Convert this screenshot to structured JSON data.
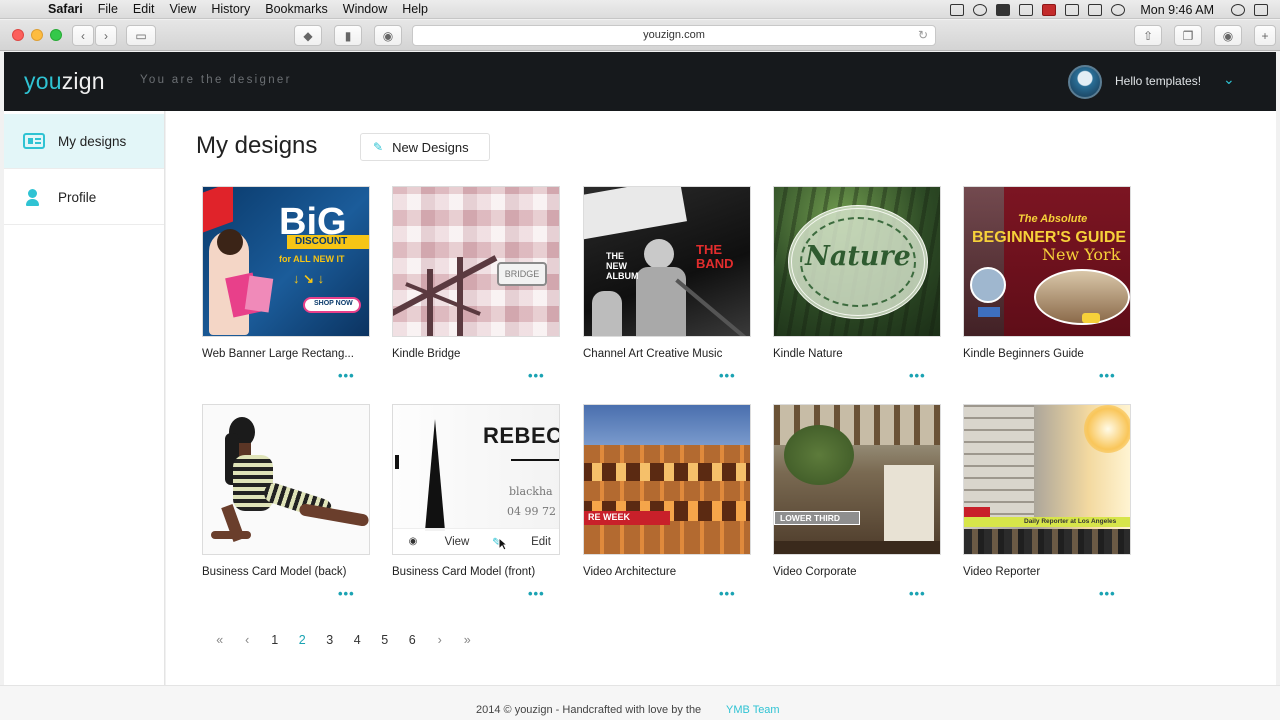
{
  "menubar": {
    "app": "Safari",
    "items": [
      "File",
      "Edit",
      "View",
      "History",
      "Bookmarks",
      "Window",
      "Help"
    ],
    "clock": "Mon 9:46 AM"
  },
  "browser": {
    "url": "youzign.com"
  },
  "header": {
    "logo_prefix": "you",
    "logo_suffix": "zign",
    "tagline": "You are the designer",
    "greeting": "Hello templates!",
    "chevron": "⌄"
  },
  "sidebar": {
    "items": [
      {
        "label": "My designs",
        "icon": "designs-icon",
        "active": true
      },
      {
        "label": "Profile",
        "icon": "profile-icon",
        "active": false
      }
    ]
  },
  "main": {
    "title": "My designs",
    "new_button": "New Designs"
  },
  "designs": [
    {
      "title": "Web Banner Large Rectang...",
      "thumb": "shopping-banner"
    },
    {
      "title": "Kindle Bridge",
      "thumb": "bridge",
      "label": "BRIDGE"
    },
    {
      "title": "Channel Art Creative Music",
      "thumb": "music",
      "label1": "THE NEW ALBUM",
      "label2": "THE BAND"
    },
    {
      "title": "Kindle Nature",
      "thumb": "nature",
      "label": "Nature"
    },
    {
      "title": "Kindle Beginners Guide",
      "thumb": "guide",
      "label1": "The Absolute",
      "label2": "BEGINNER'S GUIDE",
      "label3": "New York"
    },
    {
      "title": "Business Card Model (back)",
      "thumb": "woman-card"
    },
    {
      "title": "Business Card Model (front)",
      "thumb": "card-front",
      "label1": "REBEC",
      "label2": "blackha",
      "label3": "04 99 72",
      "view": "View",
      "edit": "Edit"
    },
    {
      "title": "Video Architecture",
      "thumb": "colosseum",
      "label": "RE WEEK"
    },
    {
      "title": "Video Corporate",
      "thumb": "corporate",
      "label": "LOWER THIRD"
    },
    {
      "title": "Video Reporter",
      "thumb": "reporter",
      "label": "Daily Reporter at Los Angeles"
    }
  ],
  "banner": {
    "word": "BiG",
    "sub": "DISCOUNT",
    "line": "for ALL NEW IT",
    "cta": "SHOP NOW"
  },
  "menu_dots": "•••",
  "pagination": {
    "first": "«",
    "prev": "‹",
    "pages": [
      "1",
      "2",
      "3",
      "4",
      "5",
      "6"
    ],
    "current": "2",
    "next": "›",
    "last": "»"
  },
  "footer": {
    "text": "2014 © youzign - Handcrafted with love by the",
    "link": "YMB Team"
  },
  "colors": {
    "accent": "#2fc3d3",
    "header_bg": "#16191c"
  }
}
